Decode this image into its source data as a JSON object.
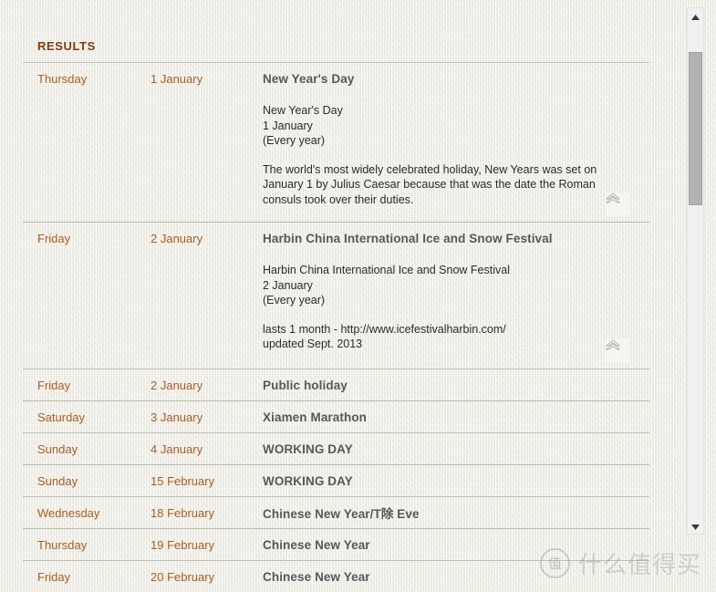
{
  "section": {
    "heading": "RESULTS"
  },
  "rows": [
    {
      "day": "Thursday",
      "date": "1 January",
      "title": "New Year's Day",
      "expanded": true,
      "detail": {
        "name": "New Year's Day",
        "date": "1 January",
        "recurrence": "(Every year)",
        "description": "The world's most widely celebrated holiday, New Years was set on January 1 by Julius Caesar because that was the date the Roman consuls took over their duties.",
        "description_lines": [
          "The world's most widely celebrated holiday, New Years was set on",
          "January 1 by Julius Caesar because that was the date the Roman",
          "consuls took over their duties."
        ],
        "collapse_icon": "chevron-up-double-icon"
      }
    },
    {
      "day": "Friday",
      "date": "2 January",
      "title": "Harbin China International Ice and Snow Festival",
      "expanded": true,
      "detail": {
        "name": "Harbin China International Ice and Snow Festival",
        "date": "2 January",
        "recurrence": "(Every year)",
        "description": "lasts 1 month - http://www.icefestivalharbin.com/",
        "description_lines": [
          "lasts 1 month - http://www.icefestivalharbin.com/",
          "updated Sept. 2013"
        ],
        "collapse_icon": "chevron-up-double-icon"
      }
    },
    {
      "day": "Friday",
      "date": "2 January",
      "title": "Public holiday",
      "expanded": false
    },
    {
      "day": "Saturday",
      "date": "3 January",
      "title": "Xiamen Marathon",
      "expanded": false
    },
    {
      "day": "Sunday",
      "date": "4 January",
      "title": "WORKING DAY",
      "expanded": false
    },
    {
      "day": "Sunday",
      "date": "15 February",
      "title": "WORKING DAY",
      "expanded": false
    },
    {
      "day": "Wednesday",
      "date": "18 February",
      "title": "Chinese New Year/T除 Eve",
      "expanded": false
    },
    {
      "day": "Thursday",
      "date": "19 February",
      "title": "Chinese New Year",
      "expanded": false
    },
    {
      "day": "Friday",
      "date": "20 February",
      "title": "Chinese New Year",
      "expanded": false
    }
  ],
  "scrollbar": {
    "up_arrow_icon": "triangle-up-icon",
    "down_arrow_icon": "triangle-down-icon",
    "thumb_label": "scrollbar-thumb"
  },
  "watermark": {
    "badge": "值",
    "text": "什么值得买"
  },
  "colors": {
    "heading": "#7b3c10",
    "day_date": "#a85e22",
    "title": "#58585a",
    "detail_text": "#2b2b2b",
    "divider": "#bfbdb0",
    "background": "#eeede2",
    "scrollbar_thumb": "#b3b3b3"
  }
}
